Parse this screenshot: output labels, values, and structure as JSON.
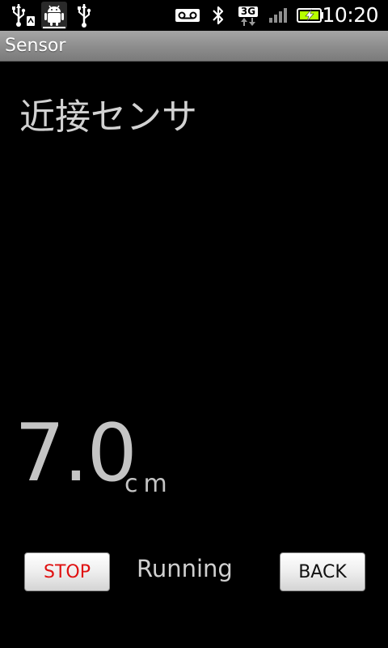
{
  "status_bar": {
    "time": "10:20",
    "network_type": "3G",
    "icons": [
      "usb-debug-icon",
      "android-icon",
      "usb-icon",
      "voicemail-icon",
      "bluetooth-icon",
      "3g-data-icon",
      "signal-icon",
      "battery-charging-icon"
    ],
    "battery_color": "#b6ff00"
  },
  "app": {
    "title": "Sensor"
  },
  "sensor": {
    "name": "近接センサ",
    "value": "7.0",
    "unit": "cm"
  },
  "controls": {
    "stop_label": "STOP",
    "state_label": "Running",
    "back_label": "BACK"
  },
  "colors": {
    "background": "#000000",
    "stop_text": "#e01010",
    "title_bar": "#8c8c8c"
  }
}
